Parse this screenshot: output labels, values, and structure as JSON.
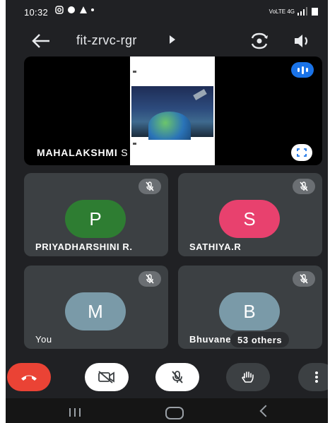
{
  "status_bar": {
    "time": "10:32",
    "network_label": "VoLTE 4G"
  },
  "meeting": {
    "code": "fit-zrvc-rgr"
  },
  "presentation": {
    "presenter_name": "MAHALAKSHMI",
    "presenting_text": "S is presenting"
  },
  "participants": [
    {
      "initial": "P",
      "name": "PRIYADHARSHINI R.",
      "avatar_color": "#2e7d32",
      "muted": true
    },
    {
      "initial": "S",
      "name": "SATHIYA.R",
      "avatar_color": "#e8416e",
      "muted": true
    },
    {
      "initial": "M",
      "name": "You",
      "avatar_color": "#7a9aa8",
      "muted": true
    },
    {
      "initial": "B",
      "name": "Bhuvane",
      "avatar_color": "#7a9aa8",
      "muted": true
    }
  ],
  "others_label": "53 others",
  "colors": {
    "background": "#202124",
    "tile": "#3c4043",
    "end_call": "#ea4335",
    "accent": "#1a73e8"
  },
  "icons": {
    "back": "arrow-left-icon",
    "switch_camera": "camera-switch-icon",
    "speaker": "speaker-icon",
    "mic_off": "mic-off-icon",
    "cam_off": "camera-off-icon",
    "end_call": "phone-hangup-icon",
    "raise_hand": "hand-icon",
    "more": "more-vertical-icon"
  }
}
